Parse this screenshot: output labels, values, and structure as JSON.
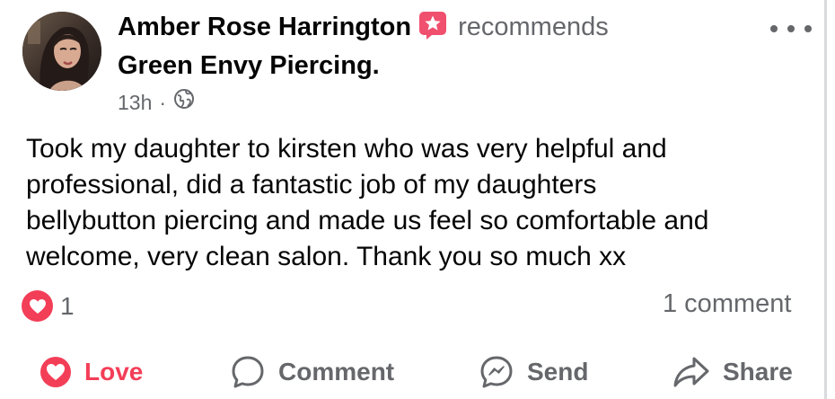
{
  "post": {
    "author_name": "Amber Rose Harrington",
    "verb": "recommends",
    "page_name": "Green Envy Piercing.",
    "time": "13h",
    "separator": "·",
    "audience_icon": "globe-icon",
    "body": "Took my daughter to kirsten who was very helpful and\nprofessional, did a fantastic job of my daughters\nbellybutton piercing and made us feel so comfortable and\nwelcome, very clean salon. Thank you so much  xx",
    "reaction_count": "1",
    "comment_count": "1 comment"
  },
  "actions": {
    "love_label": "Love",
    "comment_label": "Comment",
    "send_label": "Send",
    "share_label": "Share"
  },
  "colors": {
    "love": "#f33e58",
    "secondary_text": "#65676b",
    "primary_text": "#050505"
  }
}
